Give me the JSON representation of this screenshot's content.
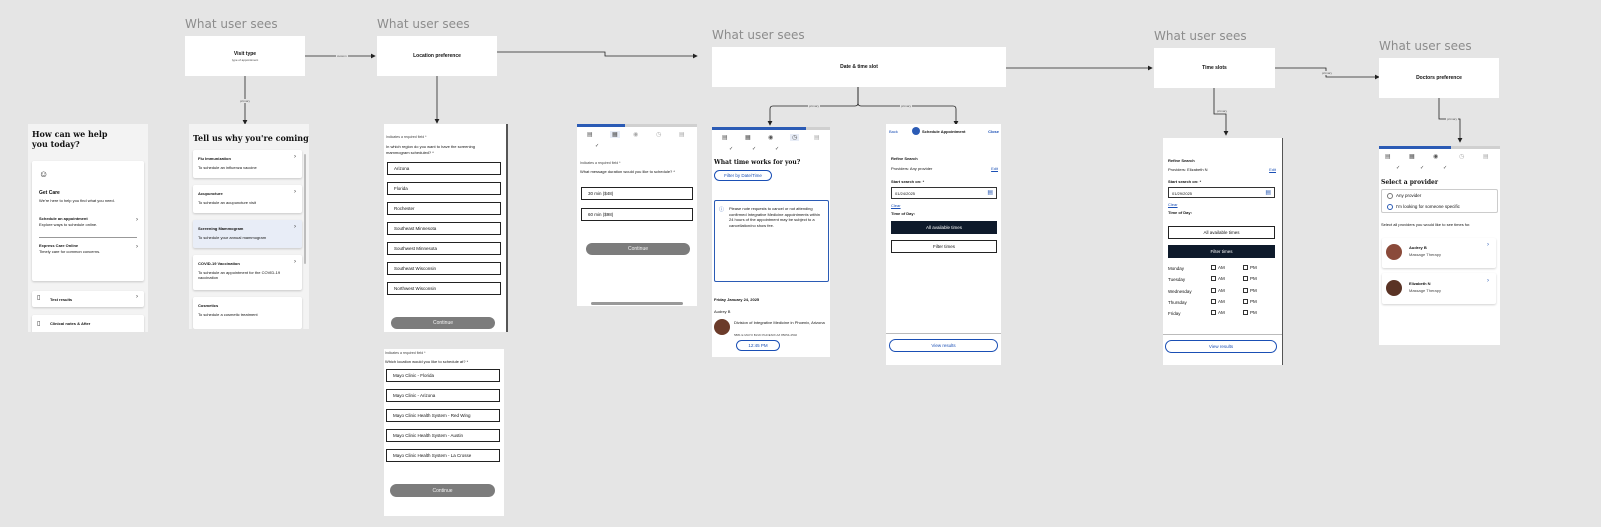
{
  "labels": {
    "what_user_sees": "What user sees",
    "edge_primary": "primary",
    "edge_custom": "custom"
  },
  "nodes": {
    "visit_type": {
      "title": "Visit type",
      "subtitle": "type of appointment"
    },
    "location_pref": {
      "title": "Location preference"
    },
    "date_time": {
      "title": "Date & time slot"
    },
    "time_slots": {
      "title": "Time slots"
    },
    "doctors_pref": {
      "title": "Doctors preference"
    }
  },
  "screen1": {
    "heading": "How can we help you today?",
    "get_care_title": "Get Care",
    "get_care_desc": "We're here to help you find what you need.",
    "schedule_title": "Schedule an appointment",
    "schedule_desc": "Explore ways to schedule online.",
    "express_title": "Express Care Online",
    "express_desc": "Timely care for common concerns.",
    "test_results": "Test results",
    "clinical_notes": "Clinical notes & After"
  },
  "screen2": {
    "heading": "Tell us why you're coming",
    "items": [
      {
        "title": "Flu Immunization",
        "desc": "To schedule an influenza vaccine"
      },
      {
        "title": "Acupuncture",
        "desc": "To schedule an acupuncture visit"
      },
      {
        "title": "Screening Mammogram",
        "desc": "To schedule your annual mammogram"
      },
      {
        "title": "COVID-19 Vaccination",
        "desc": "To schedule an appointment for the COVID-19 vaccination"
      },
      {
        "title": "Cosmetics",
        "desc": "To schedule a cosmetic treatment"
      }
    ]
  },
  "screen3": {
    "required_note": "Indicates a required field *",
    "question": "In which region do you want to have the screening mammogram scheduled? *",
    "options": [
      "Arizona",
      "Florida",
      "Rochester",
      "Southeast Minnesota",
      "Southwest Minnesota",
      "Southeast Wisconsin",
      "Northwest Wisconsin"
    ],
    "continue": "Continue"
  },
  "screen3b": {
    "required_note": "Indicates a required field *",
    "question": "Which location would you like to schedule at? *",
    "options": [
      "Mayo Clinic - Florida",
      "Mayo Clinic - Arizona",
      "Mayo Clinic Health System - Red Wing",
      "Mayo Clinic Health System - Austin",
      "Mayo Clinic Health System - La Crosse"
    ],
    "continue": "Continue"
  },
  "screen4": {
    "required_note": "Indicates a required field *",
    "question": "What message duration would you like to schedule? *",
    "options": [
      "30 min ($48)",
      "60 min ($98)"
    ],
    "continue": "Continue"
  },
  "screen5": {
    "heading": "What time works for you?",
    "filter_btn": "Filter by Date/Time",
    "notice": "Please note requests to cancel or not attending confirmed Integrative Medicine appointments within 24 hours of the appointment may be subject to a cancellation/no show fee.",
    "date": "Friday January 24, 2025",
    "provider": "Audrey B",
    "location": "Division of Integrative Medicine in Phoenix, Arizona",
    "address": "5881 E MAYO BLVD PHOENIX AZ 85054-4502",
    "slot": "12:45 PM"
  },
  "screen6": {
    "back": "Back",
    "title": "Schedule Appointment",
    "close": "Close",
    "refine": "Refine Search",
    "providers": "Providers: Any provider",
    "edit": "Edit",
    "start_label": "Start search on: *",
    "start_value": "01/24/2025",
    "clear": "Clear",
    "tod": "Time of Day:",
    "all_times": "All available times",
    "filter_times": "Filter times",
    "view_results": "View results"
  },
  "screen7": {
    "refine": "Refine Search",
    "providers": "Providers: Elizabeth N",
    "edit": "Edit",
    "start_label": "Start search on: *",
    "start_value": "01/29/2025",
    "clear": "Clear",
    "tod": "Time of Day:",
    "all_times": "All available times",
    "filter_times": "Filter times",
    "days": [
      "Monday",
      "Tuesday",
      "Wednesday",
      "Thursday",
      "Friday"
    ],
    "am": "AM",
    "pm": "PM",
    "view_results": "View results"
  },
  "screen8": {
    "heading": "Select a provider",
    "any": "Any provider",
    "specific": "I'm looking for someone specific",
    "instruction": "Select all providers you would like to see times for.",
    "providers": [
      {
        "name": "Audrey B",
        "specialty": "Massage Therapy"
      },
      {
        "name": "Elizabeth N",
        "specialty": "Massage Therapy"
      }
    ]
  },
  "colors": {
    "accent": "#2b5bb5",
    "dark_button": "#0e1a2b",
    "grey_button": "#7c7c7c"
  }
}
